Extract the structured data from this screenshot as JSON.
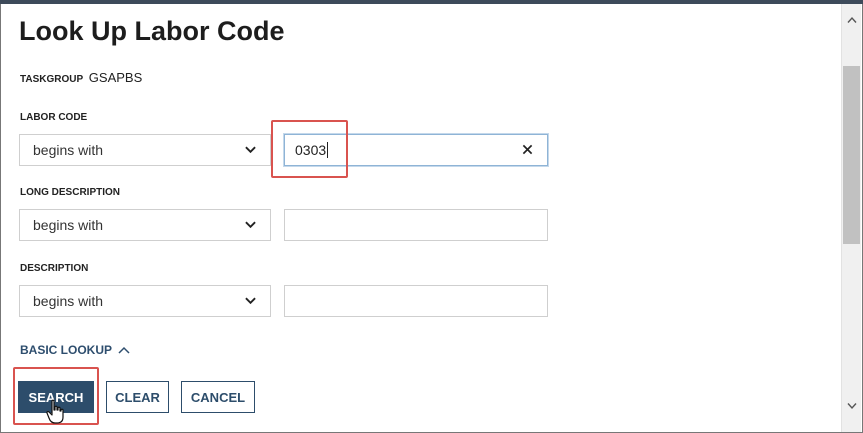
{
  "dialog": {
    "title": "Look Up Labor Code",
    "taskgroup_label": "TASKGROUP",
    "taskgroup_value": "GSAPBS"
  },
  "fields": {
    "labor_code": {
      "label": "LABOR CODE",
      "operator": "begins with",
      "value": "0303"
    },
    "long_description": {
      "label": "LONG DESCRIPTION",
      "operator": "begins with",
      "value": ""
    },
    "description": {
      "label": "DESCRIPTION",
      "operator": "begins with",
      "value": ""
    }
  },
  "basic_lookup_label": "BASIC LOOKUP",
  "buttons": {
    "search": "SEARCH",
    "clear": "CLEAR",
    "cancel": "CANCEL"
  },
  "icons": {
    "operator_dropdown": "chevron-down-icon",
    "clear_input": "close-icon",
    "basic_lookup_toggle": "chevron-up-icon",
    "pointer": "hand-cursor-icon",
    "scroll_up": "scroll-up-arrow-icon",
    "scroll_down": "scroll-down-arrow-icon"
  },
  "colors": {
    "primary": "#2d4d6b",
    "highlight": "#d9534f",
    "link": "#2e4e6e"
  }
}
